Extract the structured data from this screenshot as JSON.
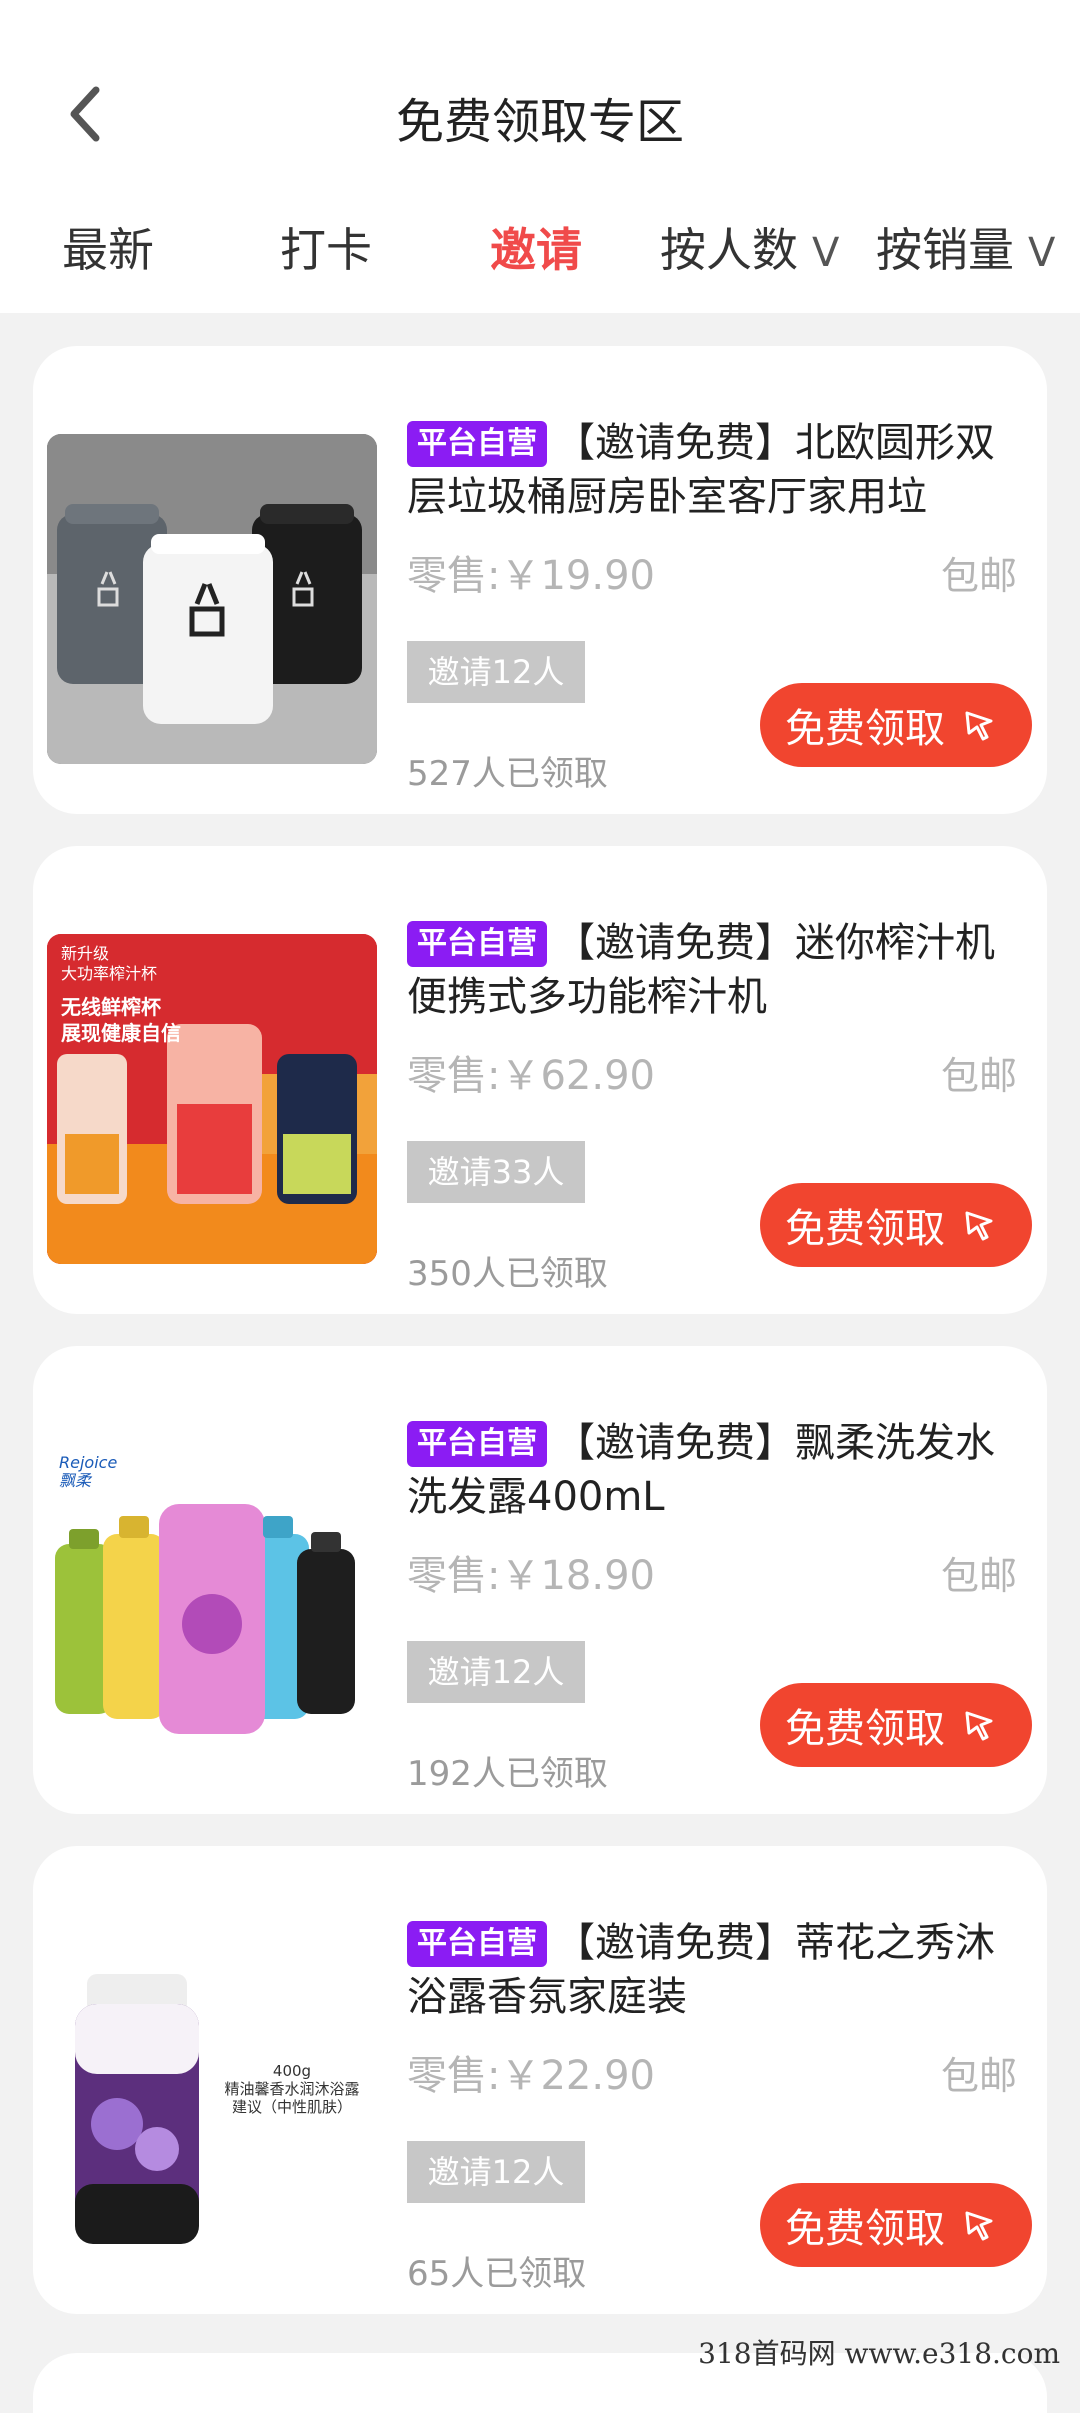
{
  "header": {
    "title": "免费领取专区",
    "back_icon": "chevron-left-icon"
  },
  "tabs": [
    {
      "label": "最新",
      "active": false
    },
    {
      "label": "打卡",
      "active": false
    },
    {
      "label": "邀请",
      "active": true
    },
    {
      "label": "按人数",
      "dropdown": "V"
    },
    {
      "label": "按销量",
      "dropdown": "V"
    }
  ],
  "colors": {
    "accent_red": "#f1452f",
    "badge_purple": "#8b1cf3",
    "active_tab": "#f04a4a"
  },
  "products": [
    {
      "badge": "平台自营",
      "title": "【邀请免费】北欧圆形双层垃圾桶厨房卧室客厅家用垃",
      "price": "零售:￥19.90",
      "shipping": "包邮",
      "invite": "邀请12人",
      "claimed": "527人已领取",
      "button": "免费领取",
      "image": "trash-bin-image"
    },
    {
      "badge": "平台自营",
      "title": "【邀请免费】迷你榨汁机 便携式多功能榨汁机",
      "price": "零售:￥62.90",
      "shipping": "包邮",
      "invite": "邀请33人",
      "claimed": "350人已领取",
      "button": "免费领取",
      "image": "juicer-image",
      "image_text": [
        "新升级",
        "大功率榨汁杯",
        "无线鲜榨杯",
        "展现健康自信"
      ]
    },
    {
      "badge": "平台自营",
      "title": "【邀请免费】飘柔洗发水洗发露400mL",
      "price": "零售:￥18.90",
      "shipping": "包邮",
      "invite": "邀请12人",
      "claimed": "192人已领取",
      "button": "免费领取",
      "image": "shampoo-image",
      "image_text": [
        "Rejoice",
        "飘柔"
      ]
    },
    {
      "badge": "平台自营",
      "title": "【邀请免费】蒂花之秀沐浴露香氛家庭装",
      "price": "零售:￥22.90",
      "shipping": "包邮",
      "invite": "邀请12人",
      "claimed": "65人已领取",
      "button": "免费领取",
      "image": "body-wash-image",
      "image_text": [
        "400g",
        "精油馨香水润沐浴露",
        "建议（中性肌肤）"
      ]
    }
  ],
  "watermark": "318首码网  www.e318.com"
}
